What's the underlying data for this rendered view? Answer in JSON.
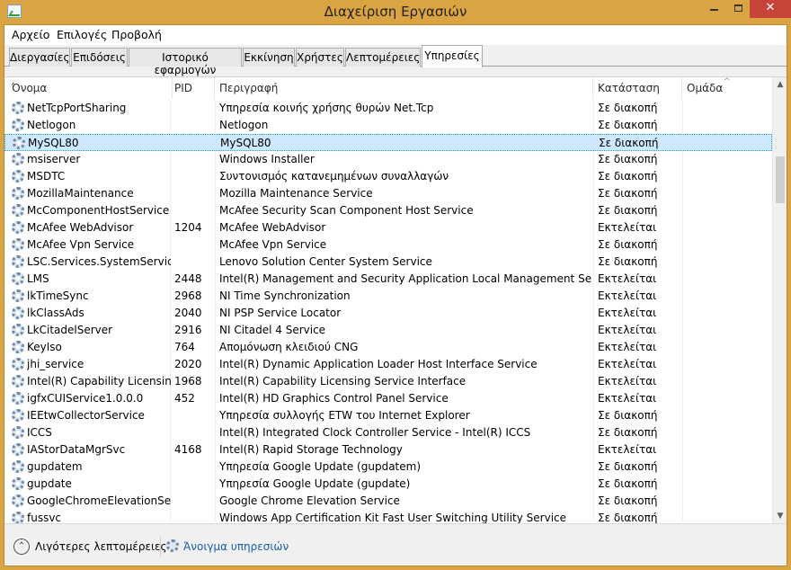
{
  "window": {
    "title": "Διαχείριση Εργασιών",
    "close_glyph": "✕"
  },
  "menu": [
    {
      "label": "Αρχείο"
    },
    {
      "label": "Επιλογές"
    },
    {
      "label": "Προβολή"
    }
  ],
  "tabs": [
    {
      "label": "Διεργασίες"
    },
    {
      "label": "Επιδόσεις"
    },
    {
      "label": "Ιστορικό εφαρμογών"
    },
    {
      "label": "Εκκίνηση"
    },
    {
      "label": "Χρήστες"
    },
    {
      "label": "Λεπτομέρειες"
    },
    {
      "label": "Υπηρεσίες"
    }
  ],
  "active_tab": "Υπηρεσίες",
  "columns": {
    "name": "Όνομα",
    "pid": "PID",
    "description": "Περιγραφή",
    "status": "Κατάσταση",
    "group": "Ομάδα"
  },
  "sort_indicator": "^",
  "services": [
    {
      "name": "NetTcpPortSharing",
      "pid": "",
      "description": "Υπηρεσία κοινής χρήσης θυρών Net.Tcp",
      "status": "Σε διακοπή",
      "group": ""
    },
    {
      "name": "Netlogon",
      "pid": "",
      "description": "Netlogon",
      "status": "Σε διακοπή",
      "group": ""
    },
    {
      "name": "MySQL80",
      "pid": "",
      "description": "MySQL80",
      "status": "Σε διακοπή",
      "group": "",
      "selected": true
    },
    {
      "name": "msiserver",
      "pid": "",
      "description": "Windows Installer",
      "status": "Σε διακοπή",
      "group": ""
    },
    {
      "name": "MSDTC",
      "pid": "",
      "description": "Συντονισμός κατανεμημένων συναλλαγών",
      "status": "Σε διακοπή",
      "group": ""
    },
    {
      "name": "MozillaMaintenance",
      "pid": "",
      "description": "Mozilla Maintenance Service",
      "status": "Σε διακοπή",
      "group": ""
    },
    {
      "name": "McComponentHostService",
      "pid": "",
      "description": "McAfee Security Scan Component Host Service",
      "status": "Σε διακοπή",
      "group": ""
    },
    {
      "name": "McAfee WebAdvisor",
      "pid": "1204",
      "description": "McAfee WebAdvisor",
      "status": "Εκτελείται",
      "group": ""
    },
    {
      "name": "McAfee Vpn Service",
      "pid": "",
      "description": "McAfee Vpn Service",
      "status": "Σε διακοπή",
      "group": ""
    },
    {
      "name": "LSC.Services.SystemService",
      "pid": "",
      "description": "Lenovo Solution Center System Service",
      "status": "Σε διακοπή",
      "group": ""
    },
    {
      "name": "LMS",
      "pid": "2448",
      "description": "Intel(R) Management and Security Application Local Management Service",
      "status": "Εκτελείται",
      "group": ""
    },
    {
      "name": "lkTimeSync",
      "pid": "2968",
      "description": "NI Time Synchronization",
      "status": "Εκτελείται",
      "group": ""
    },
    {
      "name": "lkClassAds",
      "pid": "2040",
      "description": "NI PSP Service Locator",
      "status": "Εκτελείται",
      "group": ""
    },
    {
      "name": "LkCitadelServer",
      "pid": "2916",
      "description": "NI Citadel 4 Service",
      "status": "Εκτελείται",
      "group": ""
    },
    {
      "name": "KeyIso",
      "pid": "764",
      "description": "Απομόνωση κλειδιού CNG",
      "status": "Εκτελείται",
      "group": ""
    },
    {
      "name": "jhi_service",
      "pid": "2020",
      "description": "Intel(R) Dynamic Application Loader Host Interface Service",
      "status": "Εκτελείται",
      "group": ""
    },
    {
      "name": "Intel(R) Capability Licensin...",
      "pid": "1968",
      "description": "Intel(R) Capability Licensing Service Interface",
      "status": "Εκτελείται",
      "group": ""
    },
    {
      "name": "igfxCUIService1.0.0.0",
      "pid": "452",
      "description": "Intel(R) HD Graphics Control Panel Service",
      "status": "Εκτελείται",
      "group": ""
    },
    {
      "name": "IEEtwCollectorService",
      "pid": "",
      "description": "Υπηρεσία συλλογής ETW του Internet Explorer",
      "status": "Σε διακοπή",
      "group": ""
    },
    {
      "name": "ICCS",
      "pid": "",
      "description": "Intel(R) Integrated Clock Controller Service - Intel(R) ICCS",
      "status": "Σε διακοπή",
      "group": ""
    },
    {
      "name": "IAStorDataMgrSvc",
      "pid": "4168",
      "description": "Intel(R) Rapid Storage Technology",
      "status": "Εκτελείται",
      "group": ""
    },
    {
      "name": "gupdatem",
      "pid": "",
      "description": "Υπηρεσία Google Update (gupdatem)",
      "status": "Σε διακοπή",
      "group": ""
    },
    {
      "name": "gupdate",
      "pid": "",
      "description": "Υπηρεσία Google Update (gupdate)",
      "status": "Σε διακοπή",
      "group": ""
    },
    {
      "name": "GoogleChromeElevationSer...",
      "pid": "",
      "description": "Google Chrome Elevation Service",
      "status": "Σε διακοπή",
      "group": ""
    },
    {
      "name": "fussvc",
      "pid": "",
      "description": "Windows App Certification Kit Fast User Switching Utility Service",
      "status": "Σε διακοπή",
      "group": ""
    }
  ],
  "scrollbar": {
    "up": "▲",
    "down": "▼"
  },
  "footer": {
    "fewer_details_label": "Λιγότερες λεπτομέρειες",
    "fewer_details_glyph": "⌃",
    "open_services_label": "Άνοιγμα υπηρεσιών"
  },
  "colors": {
    "titlebar": "#d9a441",
    "close_button": "#c7443b",
    "selection": "#cde8ff",
    "link": "#1a5ca6"
  },
  "icons": [
    "app-icon",
    "minimize-icon",
    "maximize-icon",
    "close-icon",
    "service-gear-icon",
    "chevron-up-icon"
  ]
}
